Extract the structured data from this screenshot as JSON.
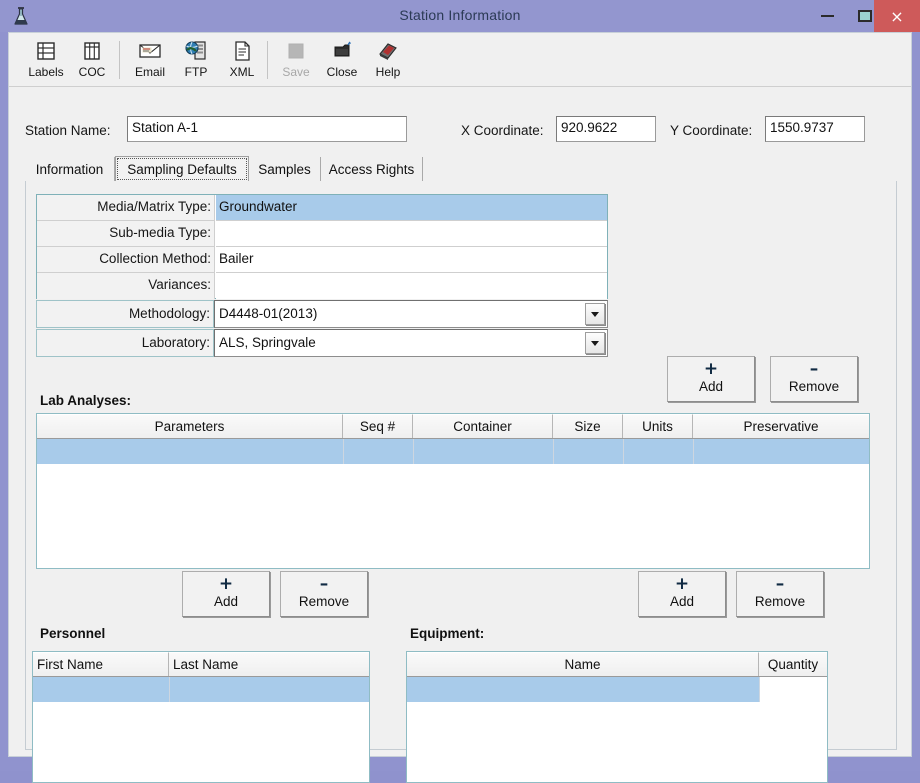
{
  "window": {
    "title": "Station Information",
    "app_icon": "flask-icon",
    "controls": {
      "minimize": "minimize-icon",
      "maximize": "maximize-icon",
      "close": "×"
    },
    "accent_titlebar": "#9396cf",
    "accent_close": "#ce5a5a",
    "accent_selection": "#a8cbea"
  },
  "toolbar": {
    "items": [
      {
        "label": "Labels",
        "icon": "labels-icon",
        "disabled": false
      },
      {
        "label": "COC",
        "icon": "coc-icon",
        "disabled": false
      },
      {
        "label": "Email",
        "icon": "email-icon",
        "disabled": false
      },
      {
        "label": "FTP",
        "icon": "ftp-icon",
        "disabled": false
      },
      {
        "label": "XML",
        "icon": "xml-icon",
        "disabled": false
      },
      {
        "label": "Save",
        "icon": "save-icon",
        "disabled": true
      },
      {
        "label": "Close",
        "icon": "close-icon",
        "disabled": false
      },
      {
        "label": "Help",
        "icon": "help-icon",
        "disabled": false
      }
    ]
  },
  "header": {
    "station_name_label": "Station Name:",
    "station_name_value": "Station A-1",
    "x_coordinate_label": "X Coordinate:",
    "x_coordinate_value": "920.9622",
    "y_coordinate_label": "Y Coordinate:",
    "y_coordinate_value": "1550.9737"
  },
  "tabs": [
    {
      "label": "Information",
      "active": false
    },
    {
      "label": "Sampling Defaults",
      "active": true
    },
    {
      "label": "Samples",
      "active": false
    },
    {
      "label": "Access Rights",
      "active": false
    }
  ],
  "sampling_defaults": {
    "properties": [
      {
        "label": "Media/Matrix Type:",
        "value": "Groundwater",
        "selected": true
      },
      {
        "label": "Sub-media Type:",
        "value": "",
        "selected": false
      },
      {
        "label": "Collection Method:",
        "value": "Bailer",
        "selected": false
      },
      {
        "label": "Variances:",
        "value": "",
        "selected": false
      }
    ],
    "combos": [
      {
        "label": "Methodology:",
        "value": "D4448-01(2013)"
      },
      {
        "label": "Laboratory:",
        "value": "ALS, Springvale"
      }
    ],
    "lab_analyses": {
      "caption": "Lab Analyses:",
      "add_label": "Add",
      "add_symbol": "+",
      "remove_label": "Remove",
      "remove_symbol": "–",
      "columns": [
        "Parameters",
        "Seq #",
        "Container",
        "Size",
        "Units",
        "Preservative"
      ],
      "rows": [
        {
          "Parameters": "",
          "Seq #": "",
          "Container": "",
          "Size": "",
          "Units": "",
          "Preservative": "",
          "selected": true
        }
      ]
    },
    "personnel": {
      "caption": "Personnel",
      "add_label": "Add",
      "add_symbol": "+",
      "remove_label": "Remove",
      "remove_symbol": "–",
      "columns": [
        "First Name",
        "Last Name"
      ],
      "rows": [
        {
          "First Name": "",
          "Last Name": "",
          "selected": true
        }
      ]
    },
    "equipment": {
      "caption": "Equipment:",
      "add_label": "Add",
      "add_symbol": "+",
      "remove_label": "Remove",
      "remove_symbol": "–",
      "columns": [
        "Name",
        "Quantity"
      ],
      "rows": [
        {
          "Name": "",
          "Quantity": "",
          "selected": true
        }
      ]
    }
  }
}
